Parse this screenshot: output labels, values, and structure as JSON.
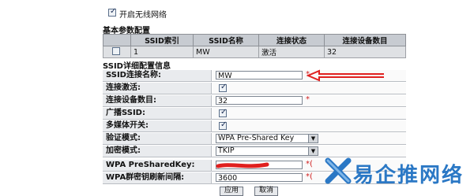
{
  "enable_wireless": {
    "label": "开启无线网络",
    "checked": true
  },
  "basic_section": {
    "title": "基本参数配置",
    "headers": [
      "",
      "SSID索引",
      "SSID名称",
      "连接状态",
      "连接设备数目"
    ],
    "rows": [
      {
        "checked": false,
        "index": "1",
        "name": "MW",
        "status": "激活",
        "devices": "32"
      }
    ]
  },
  "detail_section": {
    "title": "SSID详细配置信息",
    "ssid_name": {
      "label": "SSID连接名称:",
      "value": "MW",
      "required_mark": "*"
    },
    "enable_connection": {
      "label": "连接激活:",
      "checked": true
    },
    "device_count": {
      "label": "连接设备数目:",
      "value": "32",
      "required_mark": "*"
    },
    "broadcast_ssid": {
      "label": "广播SSID:",
      "checked": true
    },
    "multimedia": {
      "label": "多媒体开关:",
      "checked": true
    },
    "auth_mode": {
      "label": "验证模式:",
      "value": "WPA Pre-Shared Key"
    },
    "encrypt_mode": {
      "label": "加密模式:",
      "value": "TKIP"
    },
    "psk": {
      "label": "WPA PreSharedKey:",
      "required_mark": "*("
    },
    "rekey_interval": {
      "label": "WPA群密钥刷新间隔:",
      "value": "3600",
      "required_mark": "*("
    }
  },
  "buttons": {
    "apply": "应用",
    "cancel": "取消"
  },
  "watermark": {
    "text": "易企推网络"
  },
  "colors": {
    "annotation_red": "#e0201f",
    "watermark_blue": "#2b78c5",
    "label_bg": "#e9ebee"
  }
}
